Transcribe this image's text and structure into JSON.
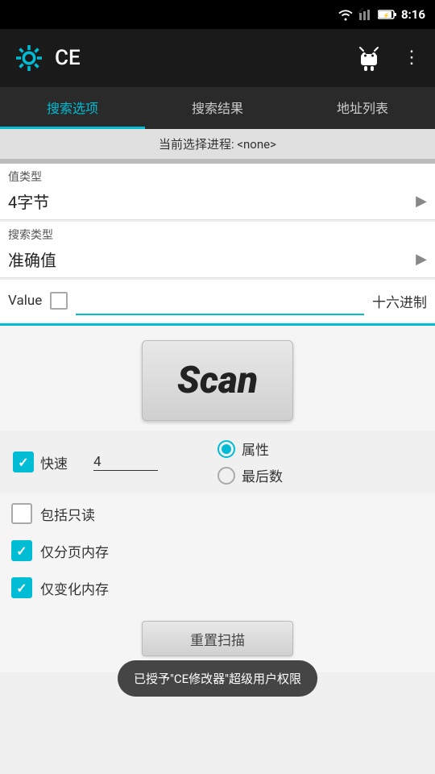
{
  "status_bar": {
    "time": "8:16"
  },
  "app_bar": {
    "title": "CE"
  },
  "tabs": {
    "items": [
      {
        "label": "搜索选项",
        "active": true
      },
      {
        "label": "搜索结果",
        "active": false
      },
      {
        "label": "地址列表",
        "active": false
      }
    ]
  },
  "process": {
    "label": "当前选择进程: <none>"
  },
  "value_type": {
    "label": "值类型",
    "value": "4字节"
  },
  "search_type": {
    "label": "搜索类型",
    "value": "准确值"
  },
  "value_row": {
    "label": "Value",
    "hex_label": "十六进制"
  },
  "scan_button": {
    "label": "Scan"
  },
  "options": {
    "fast_label": "快速",
    "fast_value": "4",
    "radio_items": [
      {
        "label": "属性",
        "selected": true
      },
      {
        "label": "最后数",
        "selected": false
      }
    ]
  },
  "checkboxes": [
    {
      "label": "包括只读",
      "checked": false
    },
    {
      "label": "仅分页内存",
      "checked": true
    },
    {
      "label": "仅变化内存",
      "checked": true
    }
  ],
  "toast": {
    "text": "已授予\"CE修改器\"超级用户权限"
  },
  "reset_button": {
    "label": "重置扫描"
  }
}
